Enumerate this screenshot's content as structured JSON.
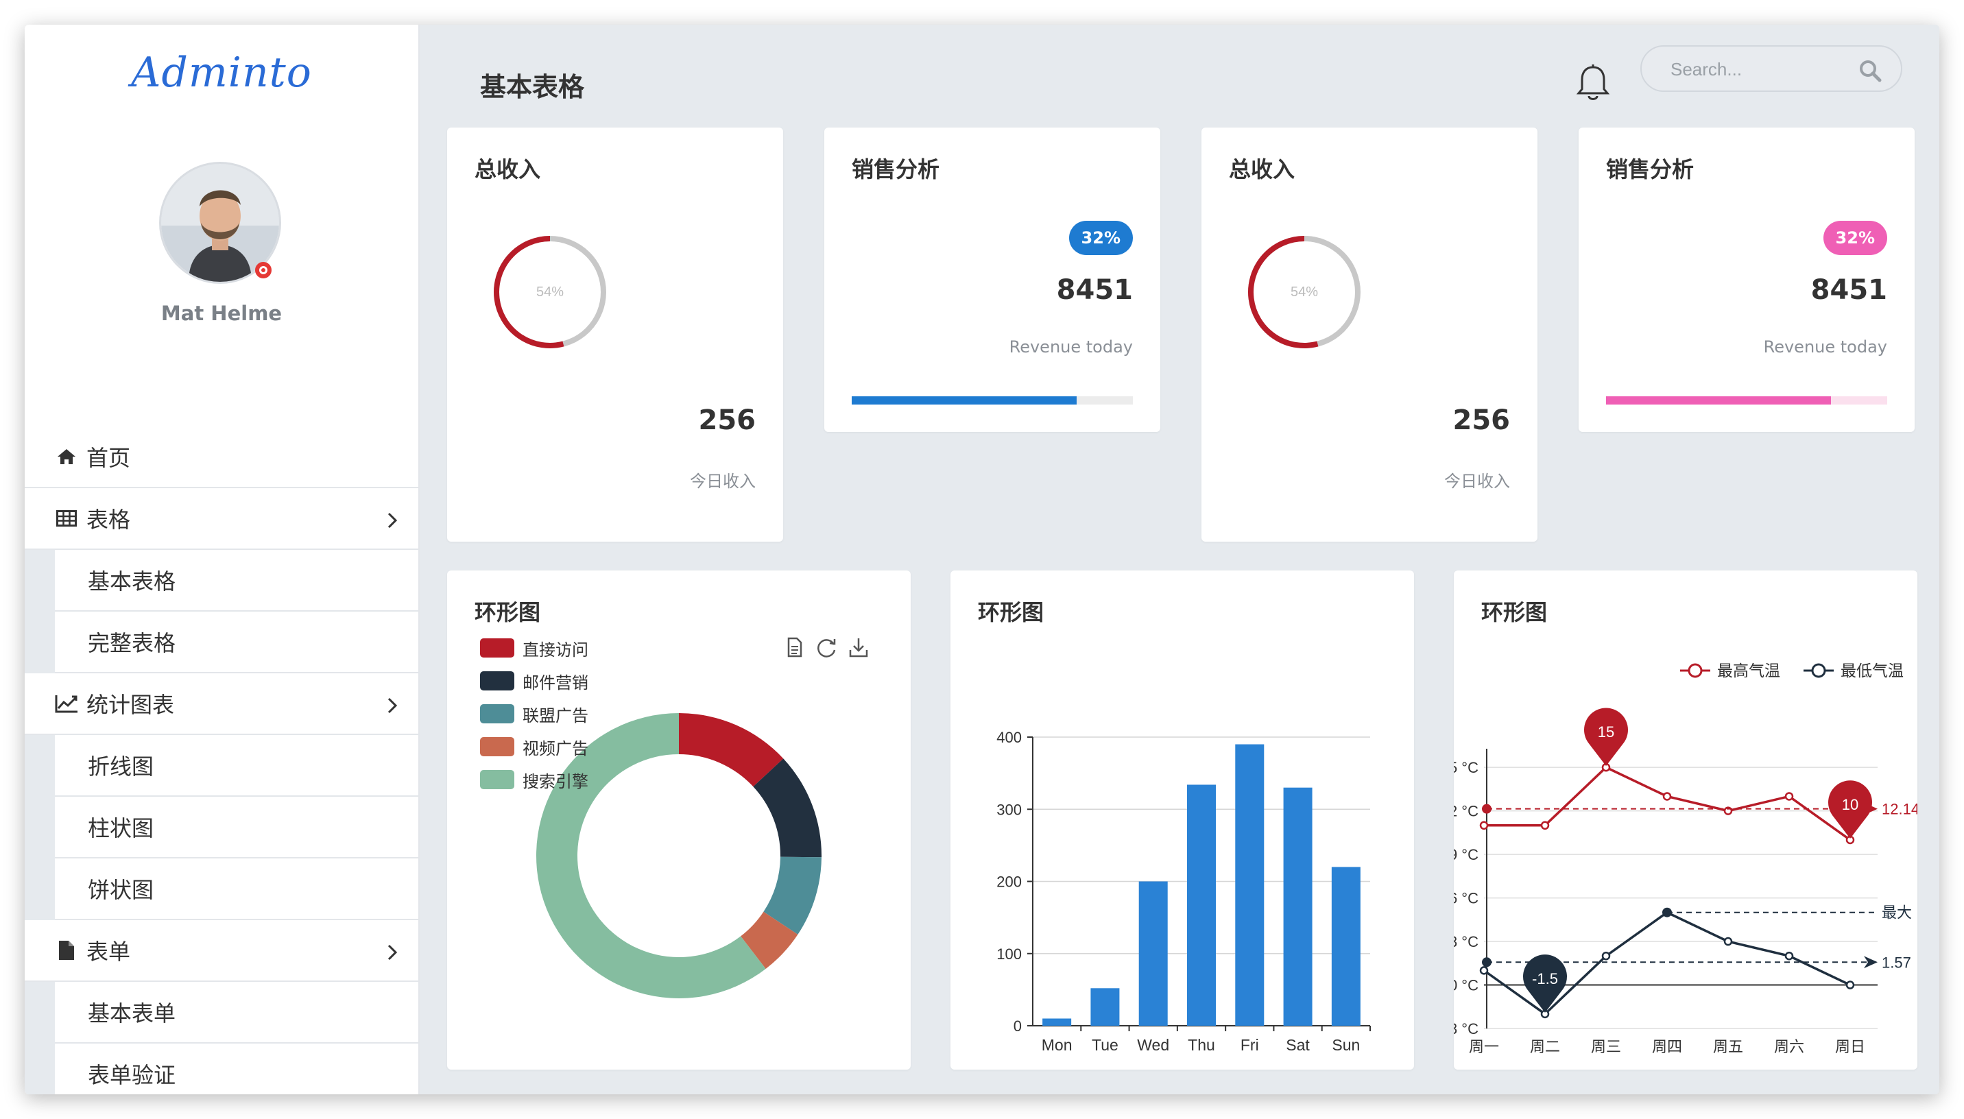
{
  "app": {
    "brand": "Adminto"
  },
  "user": {
    "name": "Mat Helme"
  },
  "header": {
    "title": "基本表格",
    "search_placeholder": "Search..."
  },
  "nav": {
    "home": "首页",
    "tables": "表格",
    "tables_sub": [
      "基本表格",
      "完整表格"
    ],
    "charts": "统计图表",
    "charts_sub": [
      "折线图",
      "柱状图",
      "饼状图"
    ],
    "forms": "表单",
    "forms_sub": [
      "基本表单",
      "表单验证"
    ]
  },
  "cards": {
    "income1": {
      "title": "总收入",
      "percent_label": "54%",
      "percent": 0.54,
      "value": "256",
      "caption": "今日收入"
    },
    "sales1": {
      "title": "销售分析",
      "badge": "32%",
      "value": "8451",
      "caption": "Revenue today",
      "progress": 0.8,
      "color": "#1e7bd1",
      "track": "#ececec"
    },
    "income2": {
      "title": "总收入",
      "percent_label": "54%",
      "percent": 0.54,
      "value": "256",
      "caption": "今日收入"
    },
    "sales2": {
      "title": "销售分析",
      "badge": "32%",
      "value": "8451",
      "caption": "Revenue today",
      "progress": 0.8,
      "color": "#ef5fb5",
      "track": "#fbe0ee"
    }
  },
  "ring_colors": {
    "arc": "#b71c28",
    "track": "#c8c8c8",
    "label": "#bbbbbb"
  },
  "panels": {
    "p1_title": "环形图",
    "p2_title": "环形图",
    "p3_title": "环形图"
  },
  "chart_data": [
    {
      "type": "pie",
      "title": "",
      "donut": true,
      "legend_position": "top-left",
      "categories": [
        "直接访问",
        "邮件营销",
        "联盟广告",
        "视频广告",
        "搜索引擎"
      ],
      "values": [
        335,
        310,
        234,
        135,
        1548
      ],
      "colors": [
        "#b71c28",
        "#22303f",
        "#4e8d97",
        "#c9694e",
        "#85bda0"
      ]
    },
    {
      "type": "bar",
      "title": "",
      "categories": [
        "Mon",
        "Tue",
        "Wed",
        "Thu",
        "Fri",
        "Sat",
        "Sun"
      ],
      "values": [
        10,
        52,
        200,
        334,
        390,
        330,
        220
      ],
      "ylim": [
        0,
        400
      ],
      "yticks": [
        0,
        100,
        200,
        300,
        400
      ],
      "grid": true,
      "color": "#2a82d5"
    },
    {
      "type": "line",
      "title": "",
      "categories": [
        "周一",
        "周二",
        "周三",
        "周四",
        "周五",
        "周六",
        "周日"
      ],
      "series": [
        {
          "name": "最高气温",
          "values": [
            11,
            11,
            15,
            13,
            12,
            13,
            10
          ],
          "color": "#b71c28",
          "max_label": "15",
          "min_label": "10",
          "avg_value": 12.14,
          "avg_label": "12.14"
        },
        {
          "name": "最低气温",
          "values": [
            1,
            -2,
            2,
            5,
            3,
            2,
            0
          ],
          "color": "#1f2f3f",
          "min_label": "-1.5",
          "max_label": "最大",
          "avg_value": 1.57,
          "avg_label": "1.57"
        }
      ],
      "ylim": [
        -3,
        16
      ],
      "ytick_values": [
        -3,
        0,
        3,
        6,
        9,
        12,
        15
      ],
      "ytick_labels": [
        "3 °C",
        "0 °C",
        "3 °C",
        "6 °C",
        "9 °C",
        "2 °C",
        "5 °C"
      ],
      "legend_position": "top-right"
    }
  ]
}
